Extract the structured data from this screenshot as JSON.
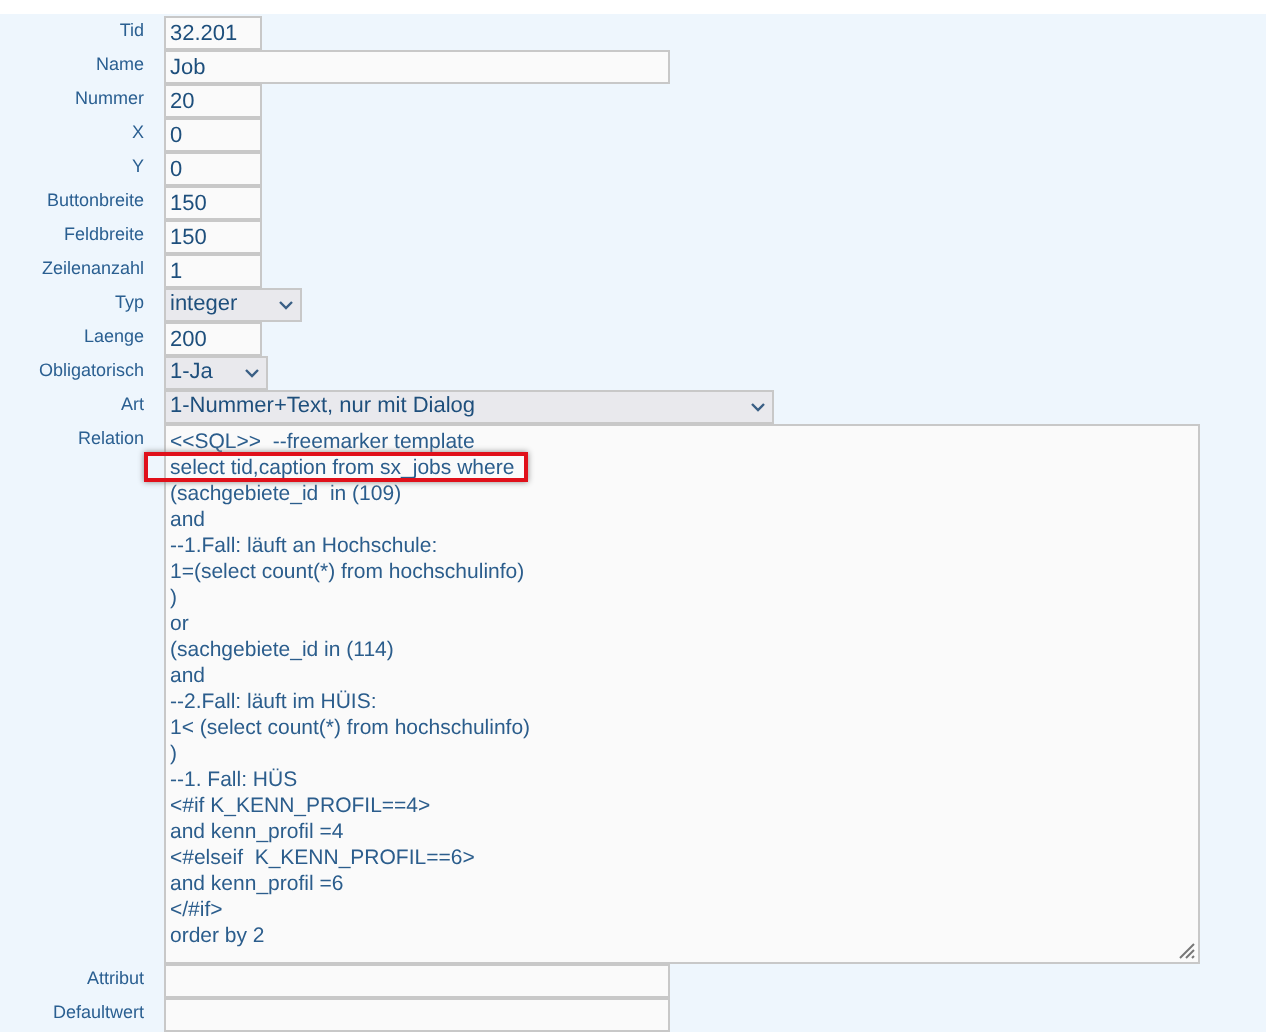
{
  "fields": [
    {
      "label": "Tid",
      "kind": "text",
      "value": "32.201"
    },
    {
      "label": "Name",
      "kind": "text",
      "value": "Job"
    },
    {
      "label": "Nummer",
      "kind": "text",
      "value": "20"
    },
    {
      "label": "X",
      "kind": "text",
      "value": "0"
    },
    {
      "label": "Y",
      "kind": "text",
      "value": "0"
    },
    {
      "label": "Buttonbreite",
      "kind": "text",
      "value": "150"
    },
    {
      "label": "Feldbreite",
      "kind": "text",
      "value": "150"
    },
    {
      "label": "Zeilenanzahl",
      "kind": "text",
      "value": "1"
    },
    {
      "label": "Typ",
      "kind": "select",
      "value": "integer"
    },
    {
      "label": "Laenge",
      "kind": "text",
      "value": "200"
    },
    {
      "label": "Obligatorisch",
      "kind": "select",
      "value": "1-Ja"
    },
    {
      "label": "Art",
      "kind": "select",
      "value": "1-Nummer+Text, nur mit Dialog"
    },
    {
      "label": "Relation",
      "kind": "textarea",
      "lines": [
        {
          "text": "<<SQL>>  --freemarker template",
          "highlighted": false
        },
        {
          "text": "select tid,caption from sx_jobs where",
          "highlighted": true
        },
        {
          "text": "(sachgebiete_id  in (109)",
          "highlighted": false
        },
        {
          "text": "and",
          "highlighted": false
        },
        {
          "text": "--1.Fall: läuft an Hochschule:",
          "highlighted": false
        },
        {
          "text": "1=(select count(*) from hochschulinfo)",
          "highlighted": false
        },
        {
          "text": ")",
          "highlighted": false
        },
        {
          "text": "or",
          "highlighted": false
        },
        {
          "text": "(sachgebiete_id in (114)",
          "highlighted": false
        },
        {
          "text": "and",
          "highlighted": false
        },
        {
          "text": "--2.Fall: läuft im HÜIS:",
          "highlighted": false
        },
        {
          "text": "1< (select count(*) from hochschulinfo)",
          "highlighted": false
        },
        {
          "text": ")",
          "highlighted": false
        },
        {
          "text": "--1. Fall: HÜS",
          "highlighted": false
        },
        {
          "text": "<#if K_KENN_PROFIL==4>",
          "highlighted": false
        },
        {
          "text": "and kenn_profil =4",
          "highlighted": false
        },
        {
          "text": "<#elseif  K_KENN_PROFIL==6>",
          "highlighted": false
        },
        {
          "text": "and kenn_profil =6",
          "highlighted": false
        },
        {
          "text": "</#if>",
          "highlighted": false
        },
        {
          "text": "order by 2",
          "highlighted": false
        }
      ]
    },
    {
      "label": "Attribut",
      "kind": "text"
    },
    {
      "label": "Defaultwert",
      "kind": "text"
    }
  ]
}
